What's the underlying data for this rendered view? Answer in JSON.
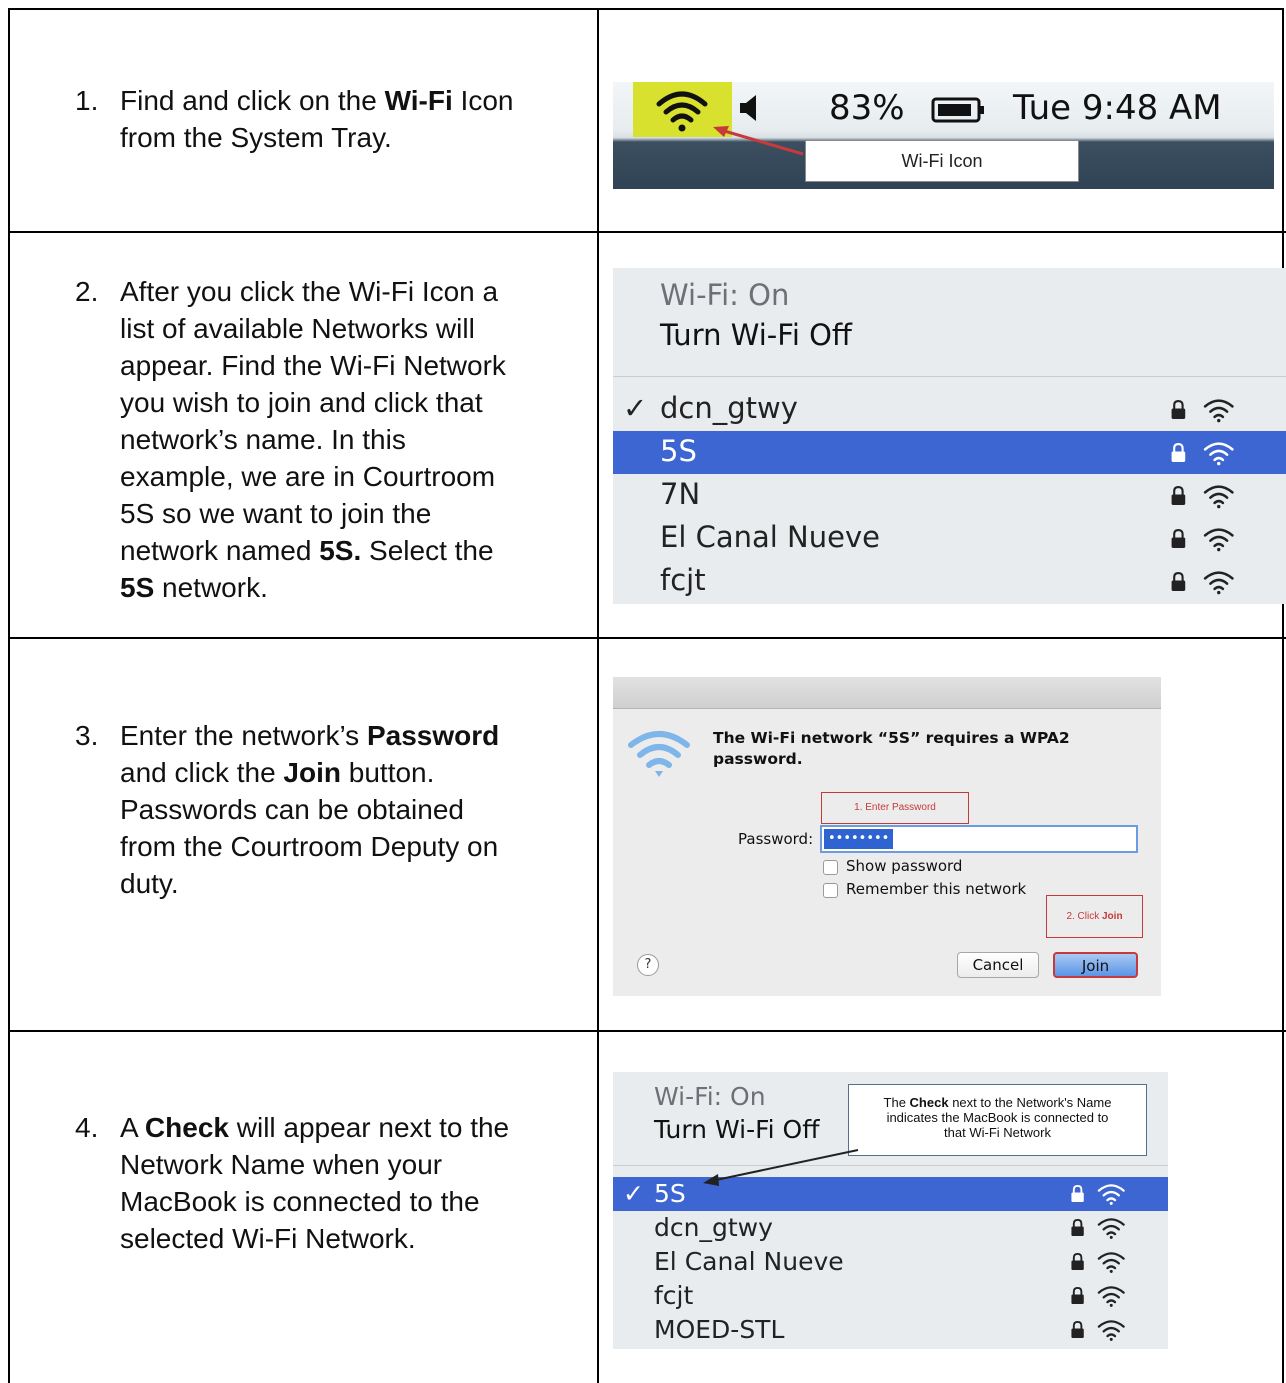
{
  "steps": [
    {
      "num": "1.",
      "lines": [
        [
          "Find and click on the ",
          {
            "b": "Wi-Fi"
          },
          " Icon"
        ],
        [
          "from the System Tray."
        ]
      ]
    },
    {
      "num": "2.",
      "lines": [
        [
          "After you click the Wi-Fi Icon a"
        ],
        [
          "list of available Networks will"
        ],
        [
          "appear. Find the Wi-Fi Network"
        ],
        [
          "you wish to join and click that"
        ],
        [
          "network’s name. In this"
        ],
        [
          "example, we are in Courtroom"
        ],
        [
          "5S so we want to join the"
        ],
        [
          "network named ",
          {
            "b": "5S."
          },
          " Select the"
        ],
        [
          {
            "b": "5S"
          },
          " network."
        ]
      ]
    },
    {
      "num": "3.",
      "lines": [
        [
          "Enter the network’s ",
          {
            "b": "Password"
          }
        ],
        [
          "and click the ",
          {
            "b": "Join"
          },
          " button."
        ],
        [
          "Passwords can be obtained"
        ],
        [
          "from the Courtroom Deputy on"
        ],
        [
          "duty."
        ]
      ]
    },
    {
      "num": "4.",
      "lines": [
        [
          "A ",
          {
            "b": "Check"
          },
          " will appear next to the"
        ],
        [
          "Network Name when your"
        ],
        [
          "MacBook is connected to the"
        ],
        [
          "selected Wi-Fi Network."
        ]
      ]
    }
  ],
  "tray": {
    "battery_pct": "83%",
    "clock": "Tue 9:48 AM",
    "label": "Wi-Fi Icon",
    "highlight_color": "#d8e12e"
  },
  "menu1": {
    "status": "Wi-Fi: On",
    "toggle": "Turn Wi-Fi Off",
    "networks": [
      {
        "name": "dcn_gtwy",
        "checked": true,
        "selected": false
      },
      {
        "name": "5S",
        "checked": false,
        "selected": true
      },
      {
        "name": "7N",
        "checked": false,
        "selected": false
      },
      {
        "name": "El Canal Nueve",
        "checked": false,
        "selected": false
      },
      {
        "name": "fcjt",
        "checked": false,
        "selected": false
      }
    ]
  },
  "dialog": {
    "message_line1": "The Wi-Fi network “5S” requires a WPA2",
    "message_line2": "password.",
    "annotation_password": "1. Enter Password",
    "password_label": "Password:",
    "password_value": "••••••••",
    "show_password": "Show password",
    "remember_network": "Remember this network",
    "annotation_join_prefix": "2. Click ",
    "annotation_join_bold": "Join",
    "help": "?",
    "cancel": "Cancel",
    "join": "Join"
  },
  "menu2": {
    "status": "Wi-Fi: On",
    "toggle": "Turn Wi-Fi Off",
    "tooltip_prefix": "The ",
    "tooltip_bold": "Check",
    "tooltip_rest1": " next to the Network's Name",
    "tooltip_line2": "indicates the MacBook is connected to",
    "tooltip_line3": "that Wi-Fi Network",
    "networks": [
      {
        "name": "5S",
        "checked": true,
        "selected": true
      },
      {
        "name": "dcn_gtwy",
        "checked": false,
        "selected": false
      },
      {
        "name": "El Canal Nueve",
        "checked": false,
        "selected": false
      },
      {
        "name": "fcjt",
        "checked": false,
        "selected": false
      },
      {
        "name": "MOED-STL",
        "checked": false,
        "selected": false
      }
    ]
  },
  "colors": {
    "selection": "#3d66d3",
    "annotation_red": "#c53a3a"
  }
}
